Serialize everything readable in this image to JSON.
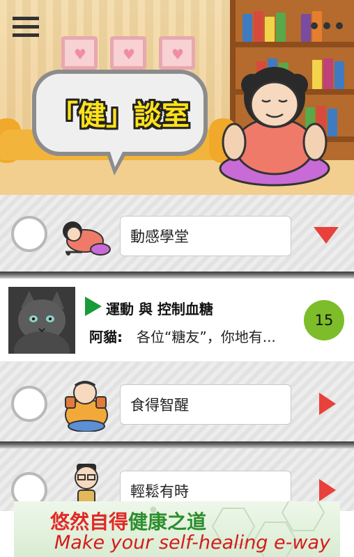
{
  "header": {
    "title": "「健」談室",
    "menu_icon": "hamburger-menu-icon",
    "more_icon": "more-dots-icon"
  },
  "categories": [
    {
      "label": "動感學堂",
      "avatar": "exercise-character-icon",
      "toggle_icon": "triangle-down-icon",
      "state": "expanded"
    },
    {
      "label": "食得智醒",
      "avatar": "eating-character-icon",
      "toggle_icon": "triangle-right-icon",
      "state": "collapsed"
    },
    {
      "label": "輕鬆有時",
      "avatar": "man-glasses-character-icon",
      "toggle_icon": "triangle-right-icon",
      "state": "collapsed"
    }
  ],
  "topic": {
    "title": "運動 與 控制血糖",
    "author": "阿貓:",
    "snippet": "各位“糖友”，你地有...",
    "count": "15",
    "thumbnail": "cat-photo"
  },
  "banner": {
    "line1_red": "悠然自得",
    "line1_green": "健康之道",
    "line2": "Make your self-healing e-way"
  },
  "colors": {
    "accent_red": "#e8403a",
    "badge_green": "#7cbd29",
    "play_green": "#199b3a",
    "title_yellow": "#ffe21a"
  }
}
